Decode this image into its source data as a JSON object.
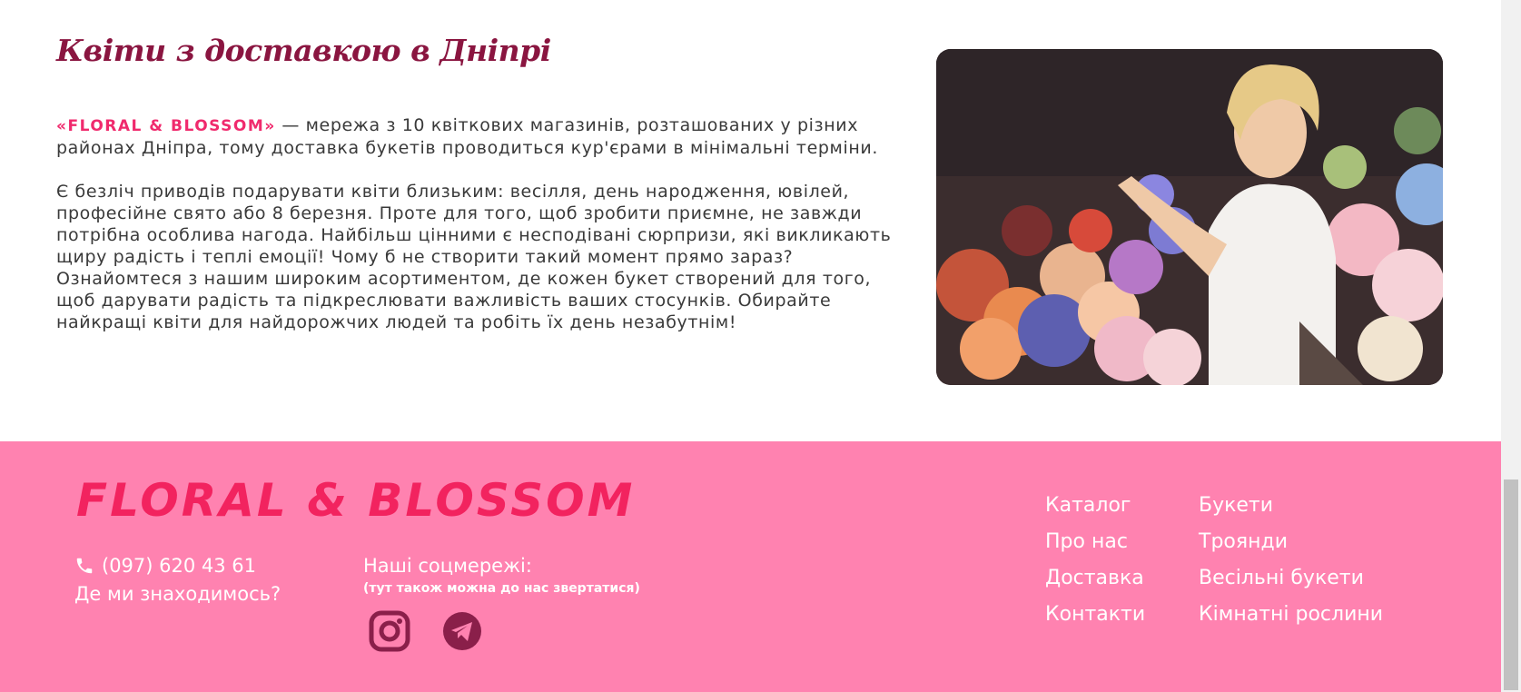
{
  "about": {
    "title": "Квіти з доставкою в Дніпрі",
    "brand_name": "«FLORAL & BLOSSOM»",
    "paragraph1_rest": " — мережа з 10 квіткових магазинів, розташованих у різних районах Дніпра, тому доставка букетів проводиться кур'єрами в мінімальні терміни.",
    "paragraph2": "Є безліч приводів подарувати квіти близьким: весілля, день народження, ювілей, професійне свято або 8 березня. Проте для того, щоб зробити приємне, не завжди потрібна особлива нагода. Найбільш цінними є несподівані сюрпризи, які викликають щиру радість і теплі емоції! Чому б не створити такий момент прямо зараз? Ознайомтеся з нашим широким асортиментом, де кожен букет створений для того, щоб дарувати радість та підкреслювати важливість ваших стосунків. Обирайте найкращі квіти для найдорожчих людей та робіть їх день незабутнім!"
  },
  "footer": {
    "logo": "FLORAL & BLOSSOM",
    "phone": "(097) 620 43 61",
    "location_link": "Де ми знаходимось?",
    "social_title": "Наші соцмережі:",
    "social_note": "(тут також можна до нас звертатися)",
    "nav_col1": [
      "Каталог",
      "Про нас",
      "Доставка",
      "Контакти"
    ],
    "nav_col2": [
      "Букети",
      "Троянди",
      "Весільні букети",
      "Кімнатні рослини"
    ]
  },
  "icons": {
    "phone": "phone-icon",
    "instagram": "instagram-icon",
    "telegram": "telegram-icon"
  },
  "colors": {
    "title": "#8a1540",
    "brand_accent": "#f02a6d",
    "footer_bg": "#ff82b0",
    "footer_logo": "#f2235f",
    "social_icon": "#8a1f4a"
  }
}
